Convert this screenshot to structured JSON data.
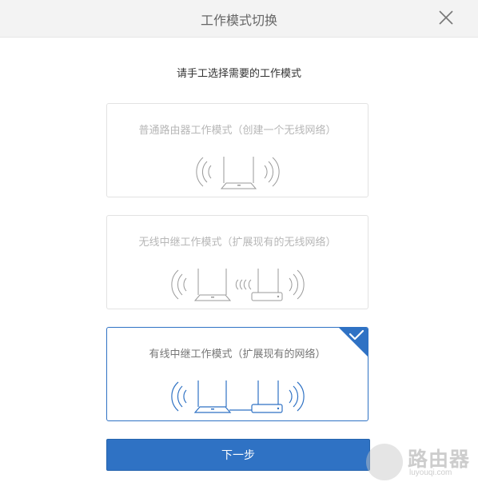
{
  "dialog": {
    "title": "工作模式切换",
    "subtitle": "请手工选择需要的工作模式"
  },
  "modes": [
    {
      "label": "普通路由器工作模式（创建一个无线网络）",
      "selected": false
    },
    {
      "label": "无线中继工作模式（扩展现有的无线网络）",
      "selected": false
    },
    {
      "label": "有线中继工作模式（扩展现有的网络）",
      "selected": true
    }
  ],
  "actions": {
    "next_label": "下一步"
  },
  "watermark": {
    "text": "路由器",
    "sub": "luyouqi.com"
  },
  "colors": {
    "accent": "#2f72c4",
    "muted_icon": "#9a9a9a"
  }
}
